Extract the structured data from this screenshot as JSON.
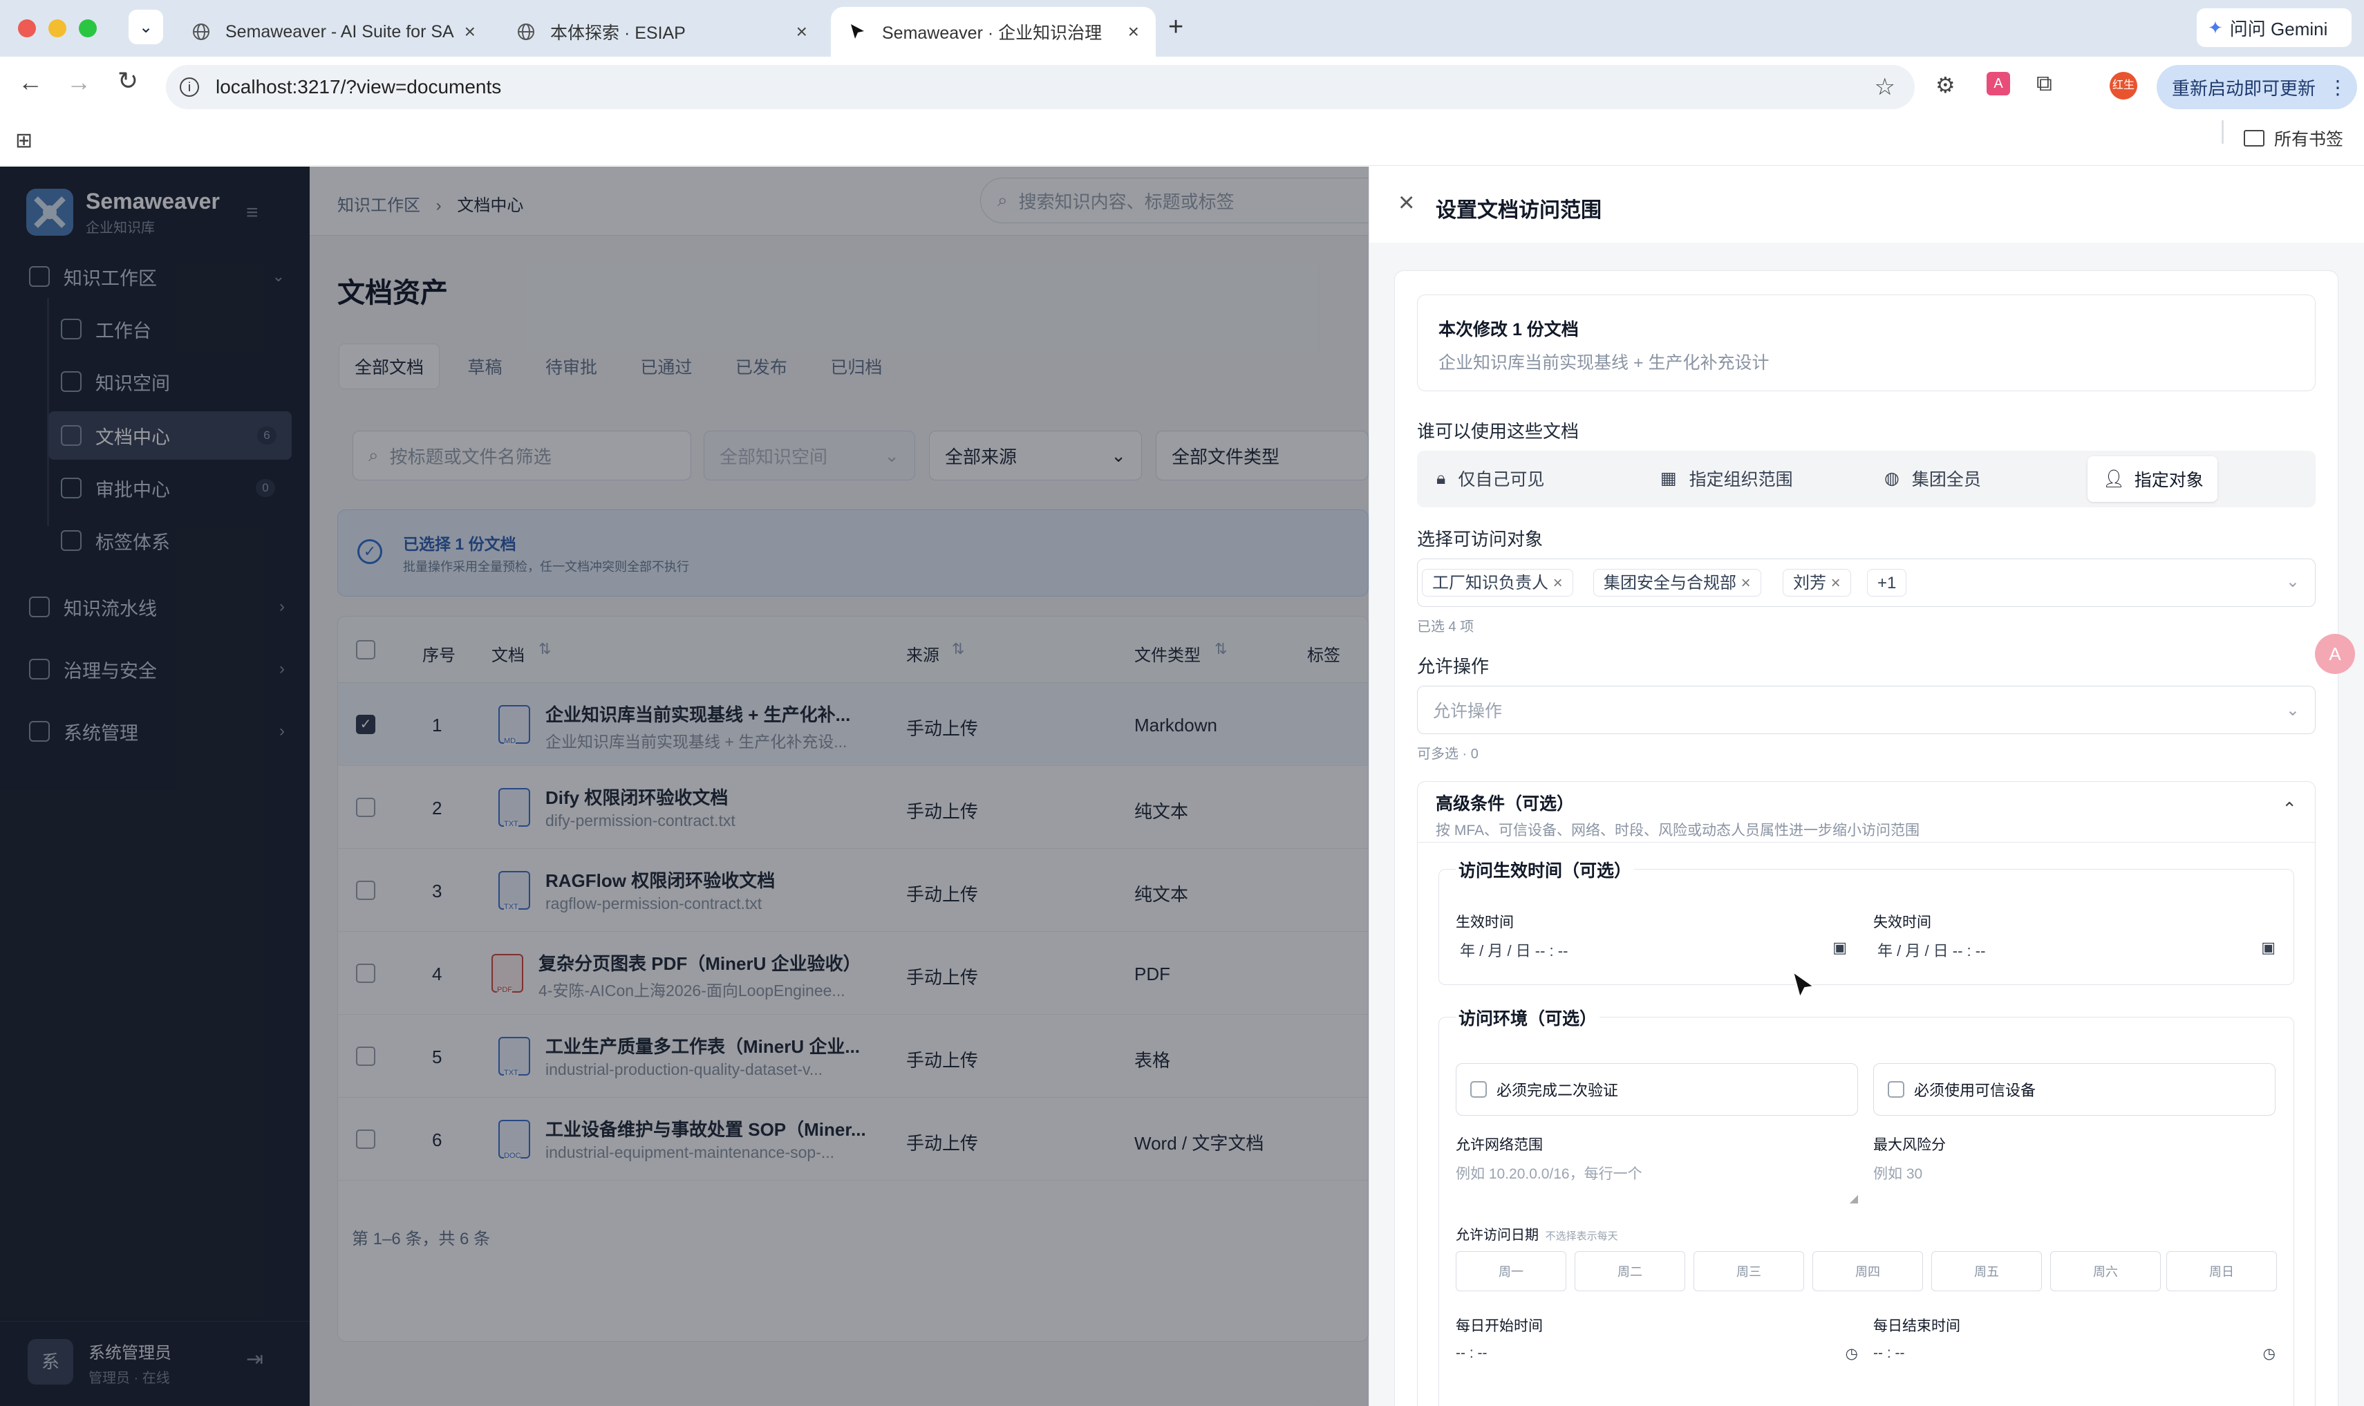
{
  "browser": {
    "tabs": [
      {
        "title": "Semaweaver - AI Suite for SA"
      },
      {
        "title": "本体探索 · ESIAP"
      },
      {
        "title": "Semaweaver · 企业知识治理"
      }
    ],
    "gemini": "问问 Gemini",
    "url": "localhost:3217/?view=documents",
    "relaunch": "重新启动即可更新",
    "avatar_text": "红生",
    "bookmarks": "所有书签"
  },
  "sidebar": {
    "brand": "Semaweaver",
    "brand_sub": "企业知识库",
    "group1": "知识工作区",
    "items": [
      {
        "label": "工作台"
      },
      {
        "label": "知识空间"
      },
      {
        "label": "文档中心",
        "badge": "6"
      },
      {
        "label": "审批中心",
        "badge": "0"
      },
      {
        "label": "标签体系"
      }
    ],
    "group2": "知识流水线",
    "group3": "治理与安全",
    "group4": "系统管理",
    "user_avatar": "系",
    "user_name": "系统管理员",
    "user_sub": "管理员 · 在线"
  },
  "main": {
    "breadcrumb_root": "知识工作区",
    "breadcrumb_current": "文档中心",
    "search_placeholder": "搜索知识内容、标题或标签",
    "page_title": "文档资产",
    "tabs": [
      "全部文档",
      "草稿",
      "待审批",
      "已通过",
      "已发布",
      "已归档"
    ],
    "filter_placeholder": "按标题或文件名筛选",
    "filter_space": "全部知识空间",
    "filter_source": "全部来源",
    "filter_type": "全部文件类型",
    "selection_title": "已选择 1 份文档",
    "selection_sub": "批量操作采用全量预检，任一文档冲突则全部不执行",
    "headers": {
      "index": "序号",
      "doc": "文档",
      "source": "来源",
      "type": "文件类型",
      "tag": "标签"
    },
    "rows": [
      {
        "idx": "1",
        "title": "企业知识库当前实现基线 + 生产化补...",
        "sub": "企业知识库当前实现基线 + 生产化补充设...",
        "ext": "MD",
        "source": "手动上传",
        "type": "Markdown",
        "checked": true
      },
      {
        "idx": "2",
        "title": "Dify 权限闭环验收文档",
        "sub": "dify-permission-contract.txt",
        "ext": "TXT",
        "source": "手动上传",
        "type": "纯文本"
      },
      {
        "idx": "3",
        "title": "RAGFlow 权限闭环验收文档",
        "sub": "ragflow-permission-contract.txt",
        "ext": "TXT",
        "source": "手动上传",
        "type": "纯文本"
      },
      {
        "idx": "4",
        "title": "复杂分页图表 PDF（MinerU 企业验收）",
        "sub": "4-安陈-AICon上海2026-面向LoopEnginee...",
        "ext": "PDF",
        "source": "手动上传",
        "type": "PDF"
      },
      {
        "idx": "5",
        "title": "工业生产质量多工作表（MinerU 企业...",
        "sub": "industrial-production-quality-dataset-v...",
        "ext": "TXT",
        "source": "手动上传",
        "type": "表格"
      },
      {
        "idx": "6",
        "title": "工业设备维护与事故处置 SOP（Miner...",
        "sub": "industrial-equipment-maintenance-sop-...",
        "ext": "DOC",
        "source": "手动上传",
        "type": "Word / 文字文档"
      }
    ],
    "pagination": "第 1–6 条，共 6 条"
  },
  "drawer": {
    "title": "设置文档访问范围",
    "summary_title": "本次修改 1 份文档",
    "summary_doc": "企业知识库当前实现基线 + 生产化补充设计",
    "who_label": "谁可以使用这些文档",
    "scopes": [
      "仅自己可见",
      "指定组织范围",
      "集团全员",
      "指定对象"
    ],
    "select_label": "选择可访问对象",
    "chips": [
      "工厂知识负责人",
      "集团安全与合规部",
      "刘芳"
    ],
    "more": "+1",
    "selected_count": "已选 4 项",
    "ops_label": "允许操作",
    "ops_placeholder": "允许操作",
    "ops_hint": "可多选 · 0",
    "adv_title": "高级条件（可选）",
    "adv_sub": "按 MFA、可信设备、网络、时段、风险或动态人员属性进一步缩小访问范围",
    "time_title": "访问生效时间（可选）",
    "start_label": "生效时间",
    "end_label": "失效时间",
    "datetime_value": "年 / 月 / 日  -- : --",
    "env_title": "访问环境（可选）",
    "mfa": "必须完成二次验证",
    "trusted": "必须使用可信设备",
    "net_label": "允许网络范围",
    "net_placeholder": "例如 10.20.0.0/16，每行一个",
    "risk_label": "最大风险分",
    "risk_placeholder": "例如 30",
    "days_label": "允许访问日期",
    "days_hint": "不选择表示每天",
    "days": [
      "周一",
      "周二",
      "周三",
      "周四",
      "周五",
      "周六",
      "周日"
    ],
    "day_start": "每日开始时间",
    "day_end": "每日结束时间",
    "time_value": "-- : --"
  }
}
